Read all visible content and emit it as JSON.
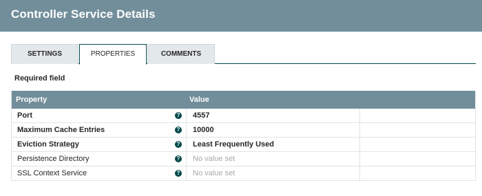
{
  "header": {
    "title": "Controller Service Details"
  },
  "tabs": [
    {
      "label": "SETTINGS",
      "active": false
    },
    {
      "label": "PROPERTIES",
      "active": true
    },
    {
      "label": "COMMENTS",
      "active": false
    }
  ],
  "required_note": "Required field",
  "table": {
    "headers": {
      "property": "Property",
      "value": "Value"
    },
    "rows": [
      {
        "name": "Port",
        "required": true,
        "value": "4557",
        "empty": false
      },
      {
        "name": "Maximum Cache Entries",
        "required": true,
        "value": "10000",
        "empty": false
      },
      {
        "name": "Eviction Strategy",
        "required": true,
        "value": "Least Frequently Used",
        "empty": false
      },
      {
        "name": "Persistence Directory",
        "required": false,
        "value": "No value set",
        "empty": true
      },
      {
        "name": "SSL Context Service",
        "required": false,
        "value": "No value set",
        "empty": true
      }
    ],
    "help_glyph": "?"
  },
  "colors": {
    "header": "#728e9b",
    "accent": "#004849"
  },
  "icons": {
    "help": "help-circle-icon"
  }
}
